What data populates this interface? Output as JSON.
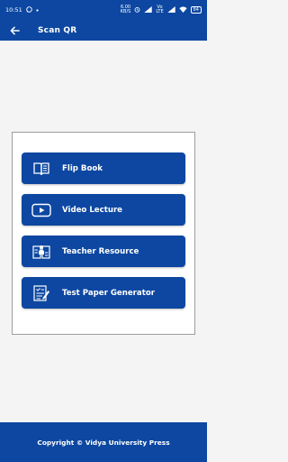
{
  "status_bar": {
    "time": "10:51",
    "network_speed_top": "6.00",
    "network_speed_bottom": "KB/S",
    "volte_top": "Vo",
    "volte_bottom": "LTE",
    "battery": "84"
  },
  "appbar": {
    "title": "Scan QR",
    "back_icon": "arrow-left-icon"
  },
  "menu": {
    "items": [
      {
        "label": "Flip Book",
        "icon": "book-icon"
      },
      {
        "label": "Video Lecture",
        "icon": "video-play-icon"
      },
      {
        "label": "Teacher Resource",
        "icon": "teacher-resource-icon"
      },
      {
        "label": "Test Paper Generator",
        "icon": "test-paper-icon"
      }
    ]
  },
  "footer": {
    "copyright": "Copyright © Vidya University Press"
  },
  "colors": {
    "primary": "#0d47a1",
    "background": "#f4f4f4",
    "panel": "#ffffff",
    "panel_border": "#9e9e9e"
  }
}
